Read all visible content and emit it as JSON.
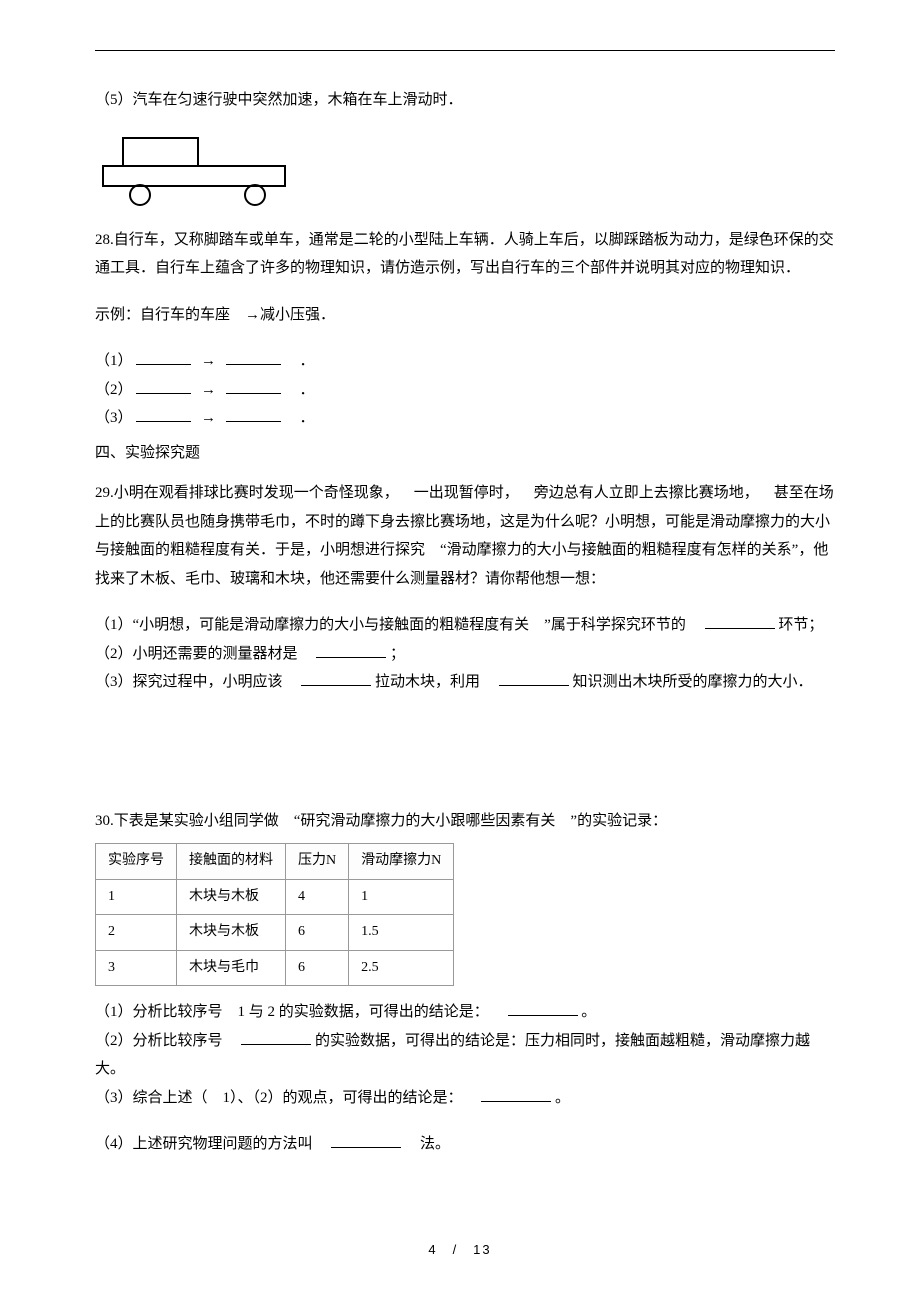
{
  "q27_5": "（5）汽车在匀速行驶中突然加速，木箱在车上滑动时．",
  "q28": {
    "intro": "28.自行车，又称脚踏车或单车，通常是二轮的小型陆上车辆．人骑上车后，以脚踩踏板为动力，是绿色环保的交通工具．自行车上蕴含了许多的物理知识，请仿造示例，写出自行车的三个部件并说明其对应的物理知识．",
    "example": "示例：自行车的车座 →减小压强．",
    "item1": "（1）",
    "item2": "（2）",
    "item3": "（3）",
    "dot": " ．"
  },
  "section4": "四、实验探究题",
  "q29": {
    "body": "29.小明在观看排球比赛时发现一个奇怪现象， 一出现暂停时， 旁边总有人立即上去擦比赛场地， 甚至在场上的比赛队员也随身携带毛巾，不时的蹲下身去擦比赛场地，这是为什么呢？小明想，可能是滑动摩擦力的大小与接触面的粗糙程度有关．于是，小明想进行探究 “滑动摩擦力的大小与接触面的粗糙程度有怎样的关系”，他找来了木板、毛巾、玻璃和木块，他还需要什么测量器材？请你帮他想一想：",
    "p1_a": "（1）“小明想，可能是滑动摩擦力的大小与接触面的粗糙程度有关 ”属于科学探究环节的 ",
    "p1_b": "环节；",
    "p2_a": "（2）小明还需要的测量器材是 ",
    "p2_b": "；",
    "p3_a": "（3）探究过程中，小明应该 ",
    "p3_b": "拉动木块，利用 ",
    "p3_c": "知识测出木块所受的摩擦力的大小．"
  },
  "q30": {
    "intro": "30.下表是某实验小组同学做 “研究滑动摩擦力的大小跟哪些因素有关 ”的实验记录：",
    "p1_a": "（1）分析比较序号 1 与 2 的实验数据，可得出的结论是： ",
    "p1_b": "。",
    "p2_a": "（2）分析比较序号 ",
    "p2_b": "的实验数据，可得出的结论是：压力相同时，接触面越粗糙，滑动摩擦力越大。",
    "p3_a": "（3）综合上述（ 1）、（2）的观点，可得出的结论是： ",
    "p3_b": "。",
    "p4_a": "（4）上述研究物理问题的方法叫 ",
    "p4_b": " 法。"
  },
  "chart_data": {
    "type": "table",
    "headers": [
      "实验序号",
      "接触面的材料",
      "压力N",
      "滑动摩擦力N"
    ],
    "rows": [
      [
        "1",
        "木块与木板",
        "4",
        "1"
      ],
      [
        "2",
        "木块与木板",
        "6",
        "1.5"
      ],
      [
        "3",
        "木块与毛巾",
        "6",
        "2.5"
      ]
    ]
  },
  "footer": "4 / 13"
}
